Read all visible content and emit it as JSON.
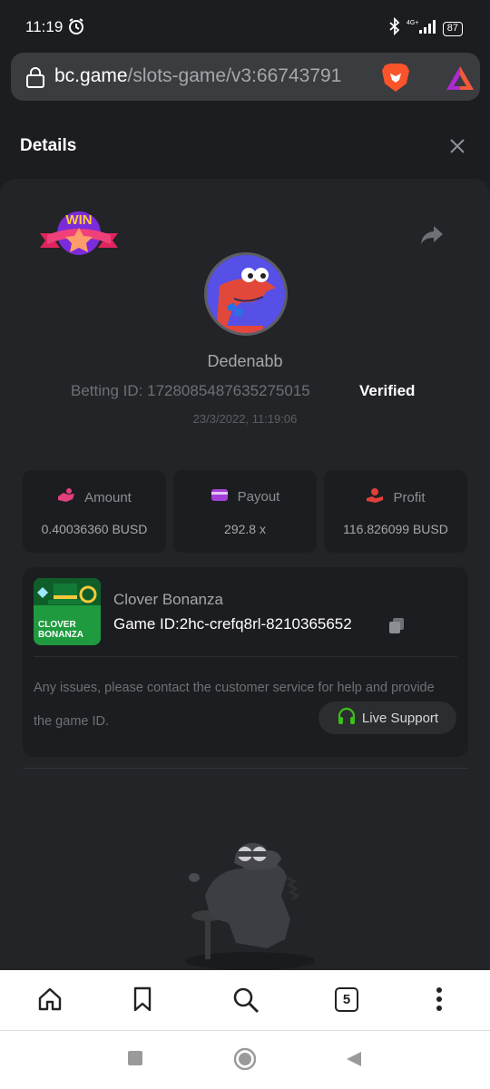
{
  "status_bar": {
    "time": "11:19",
    "battery": "87",
    "network": "4G+"
  },
  "browser": {
    "url_host": "bc.game",
    "url_path": "/slots-game/v3:66743791",
    "tab_count": "5"
  },
  "modal": {
    "title": "Details"
  },
  "bet": {
    "badge": "WIN",
    "username": "Dedenabb",
    "betting_id_label": "Betting ID:",
    "betting_id": "1728085487635275015",
    "verified": "Verified",
    "date": "23/3/2022, 11:19:06"
  },
  "stats": [
    {
      "label": "Amount",
      "value": "0.40036360 BUSD",
      "icon": "amount-icon",
      "color": "#e0407c"
    },
    {
      "label": "Payout",
      "value": "292.8 x",
      "icon": "wallet-icon",
      "color": "#a23fd9"
    },
    {
      "label": "Profit",
      "value": "116.826099 BUSD",
      "icon": "profit-icon",
      "color": "#e0403a"
    }
  ],
  "game": {
    "name": "Clover Bonanza",
    "id_label": "Game ID:",
    "id": "2hc-crefq8rl-8210365652",
    "thumb_text_1": "CLOVER",
    "thumb_text_2": "BONANZA",
    "help_text": "Any issues, please contact the customer service for help and provide the game ID.",
    "support_label": "Live Support"
  },
  "colors": {
    "accent_green": "#3bc117",
    "card_bg": "#232427",
    "page_bg": "#1c1d20"
  }
}
